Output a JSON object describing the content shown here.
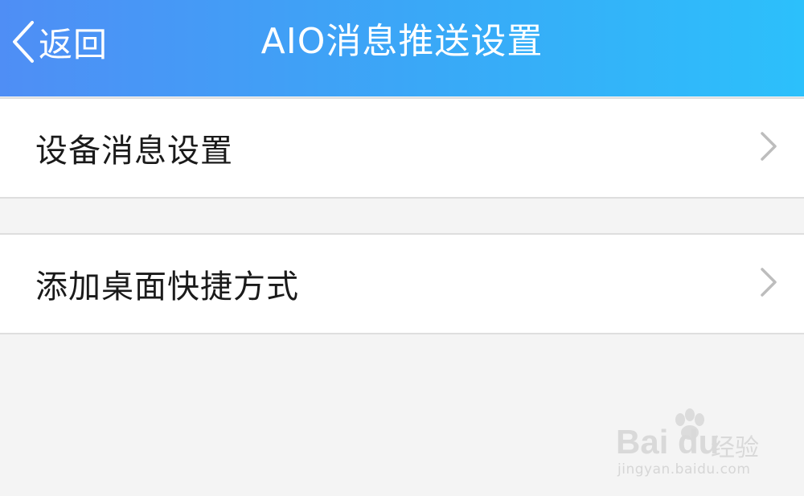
{
  "header": {
    "back_label": "返回",
    "title": "AIO消息推送设置",
    "gradient_start": "#4f8ef5",
    "gradient_end": "#2cc0fb"
  },
  "settings": {
    "items": [
      {
        "label": "设备消息设置",
        "icon": "chevron-right-icon"
      },
      {
        "label": "添加桌面快捷方式",
        "icon": "chevron-right-icon"
      }
    ]
  },
  "watermark": {
    "brand": "Bai du",
    "brand_cn": "经验",
    "url": "jingyan.baidu.com"
  }
}
